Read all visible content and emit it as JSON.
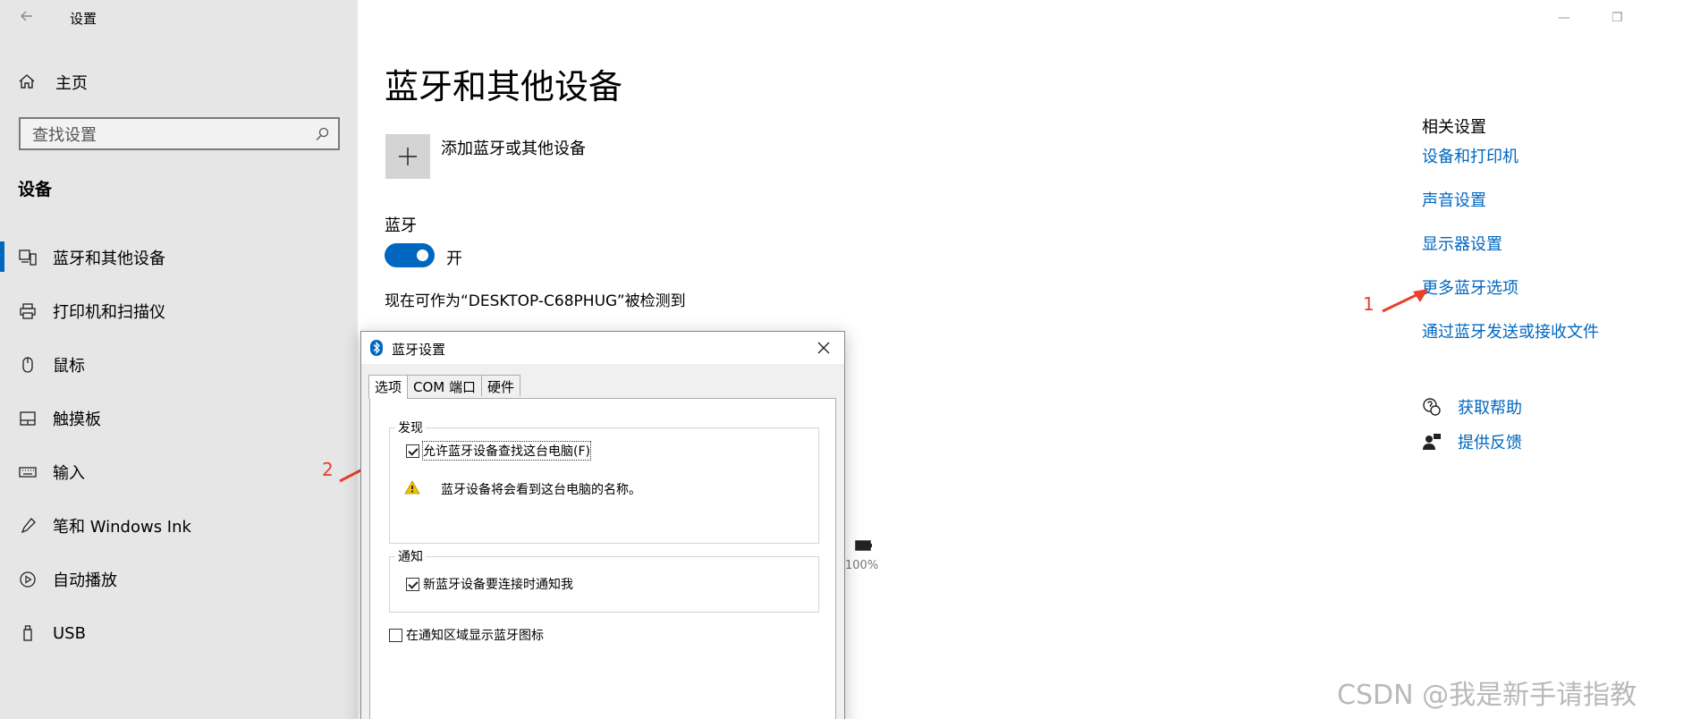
{
  "app": {
    "title": "设置",
    "back_icon": "back-arrow-icon"
  },
  "sidebar": {
    "home_label": "主页",
    "search_placeholder": "查找设置",
    "section_title": "设备",
    "items": [
      {
        "label": "蓝牙和其他设备",
        "icon": "bluetooth-devices-icon",
        "active": true
      },
      {
        "label": "打印机和扫描仪",
        "icon": "printer-icon",
        "active": false
      },
      {
        "label": "鼠标",
        "icon": "mouse-icon",
        "active": false
      },
      {
        "label": "触摸板",
        "icon": "touchpad-icon",
        "active": false
      },
      {
        "label": "输入",
        "icon": "keyboard-icon",
        "active": false
      },
      {
        "label": "笔和 Windows Ink",
        "icon": "pen-icon",
        "active": false
      },
      {
        "label": "自动播放",
        "icon": "autoplay-icon",
        "active": false
      },
      {
        "label": "USB",
        "icon": "usb-icon",
        "active": false
      }
    ]
  },
  "main": {
    "title": "蓝牙和其他设备",
    "add_device_label": "添加蓝牙或其他设备",
    "bluetooth_label": "蓝牙",
    "toggle_state": "开",
    "discoverable_text": "现在可作为“DESKTOP-C68PHUG”被检测到",
    "battery_percent": "100%"
  },
  "related": {
    "title": "相关设置",
    "links": [
      "设备和打印机",
      "声音设置",
      "显示器设置",
      "更多蓝牙选项",
      "通过蓝牙发送或接收文件"
    ],
    "help": [
      {
        "label": "获取帮助",
        "icon": "help-chat-icon"
      },
      {
        "label": "提供反馈",
        "icon": "feedback-icon"
      }
    ]
  },
  "annotations": {
    "one": "1",
    "two": "2"
  },
  "dialog": {
    "title": "蓝牙设置",
    "tabs": [
      "选项",
      "COM 端口",
      "硬件"
    ],
    "discovery_group": "发现",
    "allow_discovery": "允许蓝牙设备查找这台电脑(F)",
    "warning_text": "蓝牙设备将会看到这台电脑的名称。",
    "notify_group": "通知",
    "notify_new": "新蓝牙设备要连接时通知我",
    "show_tray_icon": "在通知区域显示蓝牙图标"
  },
  "watermark": "CSDN @我是新手请指教",
  "colors": {
    "accent": "#0067c0",
    "sidebar_bg": "#e6e6e6",
    "annotation": "#e8402a"
  }
}
